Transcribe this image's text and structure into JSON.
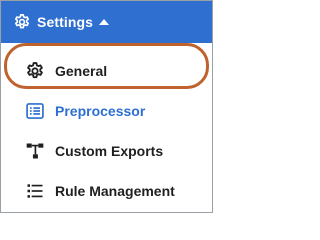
{
  "header": {
    "title": "Settings",
    "icon": "gear-icon",
    "caret_icon": "caret-up-icon",
    "background_color": "#2e6fd0"
  },
  "menu": {
    "items": [
      {
        "label": "General",
        "icon": "gear-icon",
        "active": false
      },
      {
        "label": "Preprocessor",
        "icon": "list-box-icon",
        "active": true
      },
      {
        "label": "Custom Exports",
        "icon": "hierarchy-icon",
        "active": false
      },
      {
        "label": "Rule Management",
        "icon": "list-icon",
        "active": false
      }
    ]
  },
  "highlight_color": "#c0622e"
}
